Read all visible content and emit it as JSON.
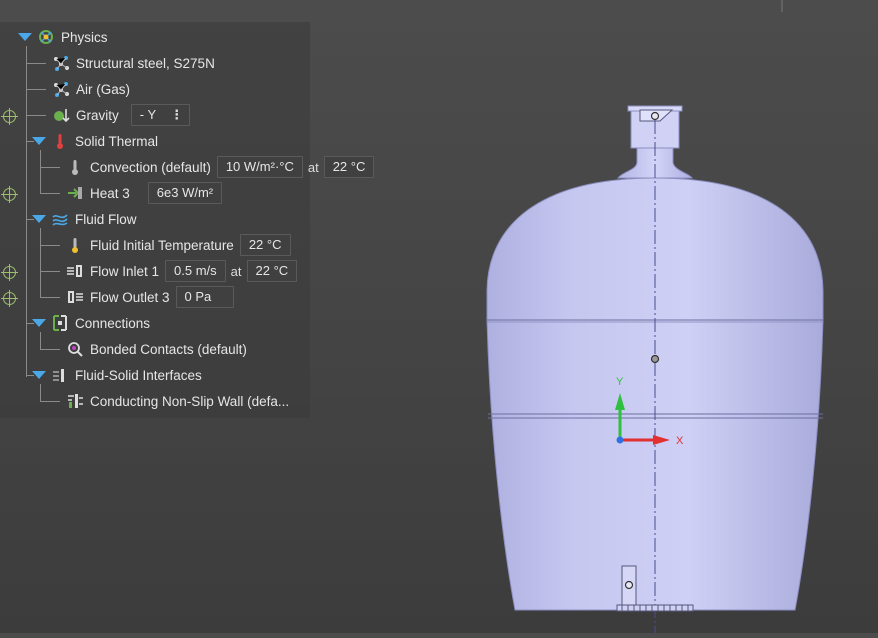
{
  "tree": {
    "physics": {
      "label": "Physics"
    },
    "material_steel": {
      "label": "Structural steel, S275N"
    },
    "material_air": {
      "label": "Air (Gas)"
    },
    "gravity": {
      "label": "Gravity",
      "value": "- Y",
      "menu": "⋮"
    },
    "solid_thermal": {
      "label": "Solid Thermal"
    },
    "convection": {
      "label": "Convection (default)",
      "value": "10 W/m²·°C",
      "at": "at",
      "temperature": "22 °C"
    },
    "heat": {
      "label": "Heat 3",
      "value": "6e3 W/m²"
    },
    "fluid_flow": {
      "label": "Fluid Flow"
    },
    "fluid_initial_temp": {
      "label": "Fluid Initial Temperature",
      "value": "22 °C"
    },
    "flow_inlet": {
      "label": "Flow Inlet 1",
      "value": "0.5 m/s",
      "at": "at",
      "temperature": "22 °C"
    },
    "flow_outlet": {
      "label": "Flow Outlet 3",
      "value": "0 Pa"
    },
    "connections": {
      "label": "Connections"
    },
    "bonded_contacts": {
      "label": "Bonded Contacts (default)"
    },
    "fluid_solid": {
      "label": "Fluid-Solid Interfaces"
    },
    "conducting_wall": {
      "label": "Conducting Non-Slip Wall (defa..."
    }
  },
  "axes": {
    "x_label": "X",
    "y_label": "Y"
  },
  "colors": {
    "tree_accent": "#4aa8e8",
    "model_fill": "#c3c3ee",
    "axis_x": "#e03030",
    "axis_y": "#30c040",
    "axis_origin": "#3070e0",
    "target": "#9cc06a"
  }
}
